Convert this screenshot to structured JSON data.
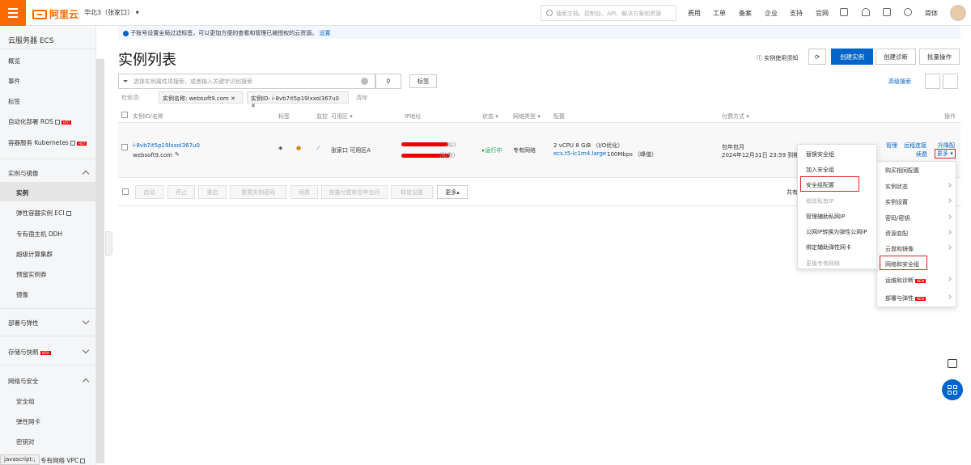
{
  "topbar": {
    "brand": "阿里云",
    "region": "华北3（张家口）",
    "search_placeholder": "搜索文档、控制台、API、解决方案和资源",
    "nav": [
      "费用",
      "工单",
      "备案",
      "企业",
      "支持",
      "官网"
    ],
    "language": "简体"
  },
  "sidebar": {
    "title": "云服务器 ECS",
    "items": [
      "概览",
      "事件",
      "标签",
      "自动化部署 ROS",
      "容器服务 Kubernetes"
    ],
    "groups": {
      "instances_images": "实例与镜像",
      "instance": "实例",
      "eci": "弹性容器实例 ECI",
      "ddh": "专有宿主机 DDH",
      "supercompute": "超级计算集群",
      "reserved": "预留实例券",
      "image": "镜像",
      "deploy": "部署与弹性",
      "storage": "存储与快照",
      "network": "网络与安全",
      "security_group": "安全组",
      "eni": "弹性网卡",
      "keypair": "密钥对",
      "vpc": "专有网络 VPC"
    },
    "new_tag": "NEW",
    "hot_tag": "HOT"
  },
  "notice": {
    "text": "子账号设置全局过滤标签，可以更加方便的查看和管理已被授权的云资源。",
    "link": "设置"
  },
  "page": {
    "title": "实例列表",
    "usage_link": "实例使用须知",
    "create_button": "创建实例",
    "diagnose_button": "创建诊断",
    "batch_button": "批量操作",
    "filter_placeholder": "选择实例属性项搜索，或者输入关键字识别搜索",
    "tag_button": "标签",
    "advanced_search": "高级搜索",
    "tag_filter_label": "检索项:",
    "chips": [
      "实例名称: websoft9.com",
      "实例ID: i-8vb7it5p19lxxol367u0"
    ],
    "clear": "清除"
  },
  "table": {
    "headers": [
      "实例ID/名称",
      "标签",
      "监控",
      "可用区 ▾",
      "IP地址",
      "状态 ▾",
      "网络类型 ▾",
      "配置",
      "付费方式 ▾",
      "操作"
    ],
    "row": {
      "id": "i-8vb7it5p19lxxol367u0",
      "name": "websoft9.com",
      "zone": "张家口 可用区A",
      "ip_public_suffix": "(公)",
      "ip_private_suffix": "(私有)",
      "status": "运行中",
      "network": "专有网络",
      "spec": "2 vCPU 8 GiB （I/O优化）",
      "instance_type": "ecs.t5-lc1m4.large",
      "bandwidth": "100Mbps （峰值）",
      "billing": "包年包月",
      "expire": "2024年12月31日 23:59 到期",
      "ops": [
        "管理",
        "远程连接",
        "升降配",
        "续费",
        "更多"
      ]
    },
    "footer_buttons": [
      "启动",
      "停止",
      "重启",
      "重置实例密码",
      "续费",
      "按量付费转包年包月",
      "释放设置",
      "更多▴"
    ],
    "total_prefix": "共有"
  },
  "menu_right": [
    "购买相同配置",
    "实例状态",
    "实例设置",
    "密码/密钥",
    "资源变配",
    "云盘和镜像",
    "网络和安全组",
    "运维和诊断",
    "部署与弹性"
  ],
  "menu_left": [
    "替换安全组",
    "加入安全组",
    "安全组配置",
    "修改私有IP",
    "管理辅助私网IP",
    "公网IP转换为弹性公网IP",
    "绑定辅助弹性网卡",
    "更换专有网络"
  ],
  "statusbar": "javascript:;",
  "colors": {
    "accent": "#ff6a00",
    "primary": "#0064c8",
    "highlight": "#e02020"
  }
}
